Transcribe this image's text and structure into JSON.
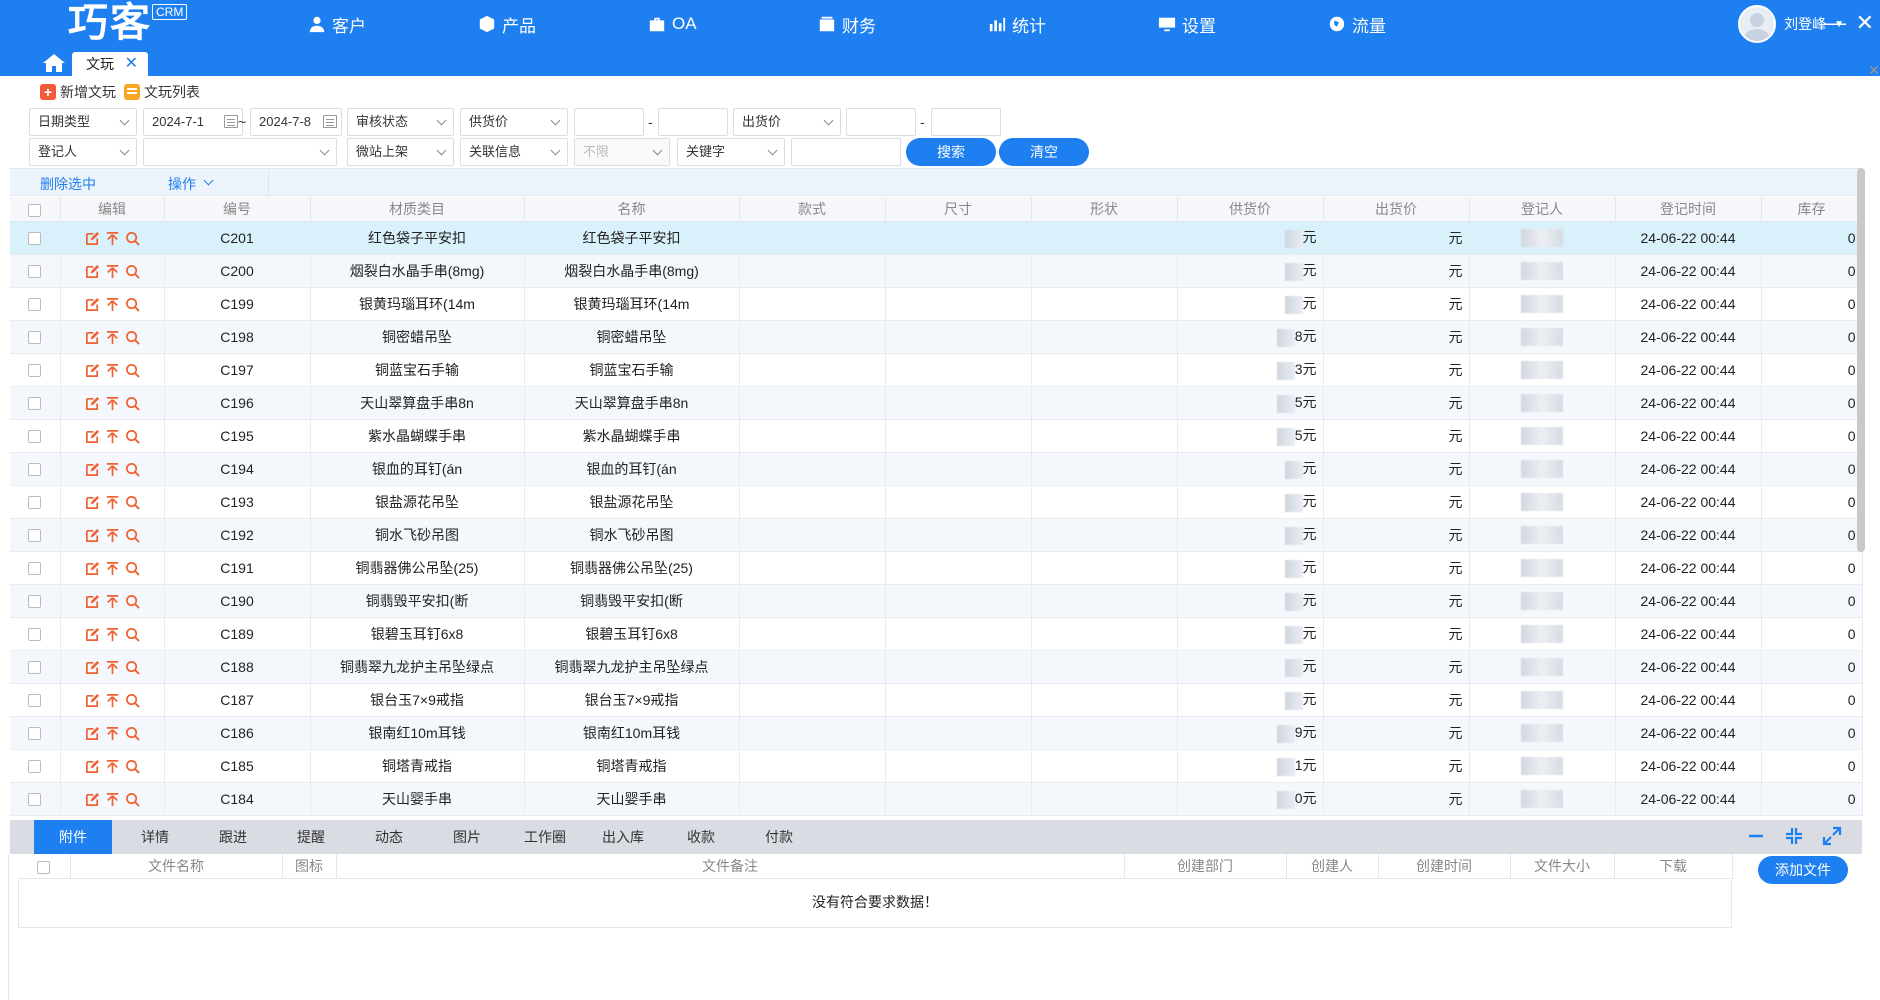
{
  "app": {
    "logo": "巧客",
    "badge": "CRM"
  },
  "nav": [
    {
      "label": "客户",
      "icon": "user-icon"
    },
    {
      "label": "产品",
      "icon": "cube-icon"
    },
    {
      "label": "OA",
      "icon": "briefcase-icon"
    },
    {
      "label": "财务",
      "icon": "wallet-icon"
    },
    {
      "label": "统计",
      "icon": "chart-icon"
    },
    {
      "label": "设置",
      "icon": "monitor-icon"
    },
    {
      "label": "流量",
      "icon": "globe-icon"
    }
  ],
  "user": {
    "name": "刘登峰"
  },
  "tab": {
    "label": "文玩"
  },
  "toolbar": {
    "add_label": "新增文玩",
    "list_label": "文玩列表"
  },
  "filters": {
    "date_type": "日期类型",
    "date_from": "2024-7-1",
    "tilde": "~",
    "date_to": "2024-7-8",
    "audit_status": "审核状态",
    "supply_price": "供货价",
    "dash": "-",
    "sale_price": "出货价",
    "registrar": "登记人",
    "micro_site": "微站上架",
    "related_info": "关联信息",
    "unlimited": "不限",
    "keyword": "关键字",
    "search_btn": "搜索",
    "clear_btn": "清空"
  },
  "actions": {
    "delete_selected": "删除选中",
    "operate": "操作"
  },
  "table": {
    "headers": [
      "编辑",
      "编号",
      "材质类目",
      "名称",
      "款式",
      "尺寸",
      "形状",
      "供货价",
      "出货价",
      "登记人",
      "登记时间",
      "库存"
    ],
    "rows": [
      {
        "id": "C201",
        "cat": "红色袋子平安扣",
        "name": "红色袋子平安扣",
        "supply": "元",
        "sale": "元",
        "time": "24-06-22 00:44",
        "stock": "0"
      },
      {
        "id": "C200",
        "cat": "烟裂白水晶手串(8mg)",
        "name": "烟裂白水晶手串(8mg)",
        "supply": "元",
        "sale": "元",
        "time": "24-06-22 00:44",
        "stock": "0"
      },
      {
        "id": "C199",
        "cat": "银黄玛瑙耳环(14m",
        "name": "银黄玛瑙耳环(14m",
        "supply": "元",
        "sale": "元",
        "time": "24-06-22 00:44",
        "stock": "0"
      },
      {
        "id": "C198",
        "cat": "铜密蜡吊坠",
        "name": "铜密蜡吊坠",
        "supply": "8元",
        "sale": "元",
        "time": "24-06-22 00:44",
        "stock": "0"
      },
      {
        "id": "C197",
        "cat": "铜蓝宝石手输",
        "name": "铜蓝宝石手输",
        "supply": "3元",
        "sale": "元",
        "time": "24-06-22 00:44",
        "stock": "0"
      },
      {
        "id": "C196",
        "cat": "天山翠算盘手串8n",
        "name": "天山翠算盘手串8n",
        "supply": "5元",
        "sale": "元",
        "time": "24-06-22 00:44",
        "stock": "0"
      },
      {
        "id": "C195",
        "cat": "紫水晶蝴蝶手串",
        "name": "紫水晶蝴蝶手串",
        "supply": "5元",
        "sale": "元",
        "time": "24-06-22 00:44",
        "stock": "0"
      },
      {
        "id": "C194",
        "cat": "银血的耳钉(án",
        "name": "银血的耳钉(án",
        "supply": "元",
        "sale": "元",
        "time": "24-06-22 00:44",
        "stock": "0"
      },
      {
        "id": "C193",
        "cat": "银盐源花吊坠",
        "name": "银盐源花吊坠",
        "supply": "元",
        "sale": "元",
        "time": "24-06-22 00:44",
        "stock": "0"
      },
      {
        "id": "C192",
        "cat": "铜水飞砂吊图",
        "name": "铜水飞砂吊图",
        "supply": "元",
        "sale": "元",
        "time": "24-06-22 00:44",
        "stock": "0"
      },
      {
        "id": "C191",
        "cat": "铜翡器佛公吊坠(25)",
        "name": "铜翡器佛公吊坠(25)",
        "supply": "元",
        "sale": "元",
        "time": "24-06-22 00:44",
        "stock": "0"
      },
      {
        "id": "C190",
        "cat": "铜翡毁平安扣(断",
        "name": "铜翡毁平安扣(断",
        "supply": "元",
        "sale": "元",
        "time": "24-06-22 00:44",
        "stock": "0"
      },
      {
        "id": "C189",
        "cat": "银碧玉耳钉6x8",
        "name": "银碧玉耳钉6x8",
        "supply": "元",
        "sale": "元",
        "time": "24-06-22 00:44",
        "stock": "0"
      },
      {
        "id": "C188",
        "cat": "铜翡翠九龙护主吊坠绿点",
        "name": "铜翡翠九龙护主吊坠绿点",
        "supply": "元",
        "sale": "元",
        "time": "24-06-22 00:44",
        "stock": "0"
      },
      {
        "id": "C187",
        "cat": "银台玉7×9戒指",
        "name": "银台玉7×9戒指",
        "supply": "元",
        "sale": "元",
        "time": "24-06-22 00:44",
        "stock": "0"
      },
      {
        "id": "C186",
        "cat": "银南红10m耳钱",
        "name": "银南红10m耳钱",
        "supply": "9元",
        "sale": "元",
        "time": "24-06-22 00:44",
        "stock": "0"
      },
      {
        "id": "C185",
        "cat": "铜塔青戒指",
        "name": "铜塔青戒指",
        "supply": "1元",
        "sale": "元",
        "time": "24-06-22 00:44",
        "stock": "0"
      },
      {
        "id": "C184",
        "cat": "天山婴手串",
        "name": "天山婴手串",
        "supply": "0元",
        "sale": "元",
        "time": "24-06-22 00:44",
        "stock": "0"
      }
    ]
  },
  "lower_tabs": [
    "附件",
    "详情",
    "跟进",
    "提醒",
    "动态",
    "图片",
    "工作圈",
    "出入库",
    "收款",
    "付款"
  ],
  "sub_table": {
    "headers": [
      "文件名称",
      "图标",
      "文件备注",
      "创建部门",
      "创建人",
      "创建时间",
      "文件大小",
      "下载"
    ],
    "empty_text": "没有符合要求数据！",
    "add_button": "添加文件"
  },
  "colors": {
    "primary": "#1e7ff0",
    "highlight_row": "#d9f1fb",
    "alt_row": "#f4f8fd",
    "edit_icon": "#f06030"
  }
}
